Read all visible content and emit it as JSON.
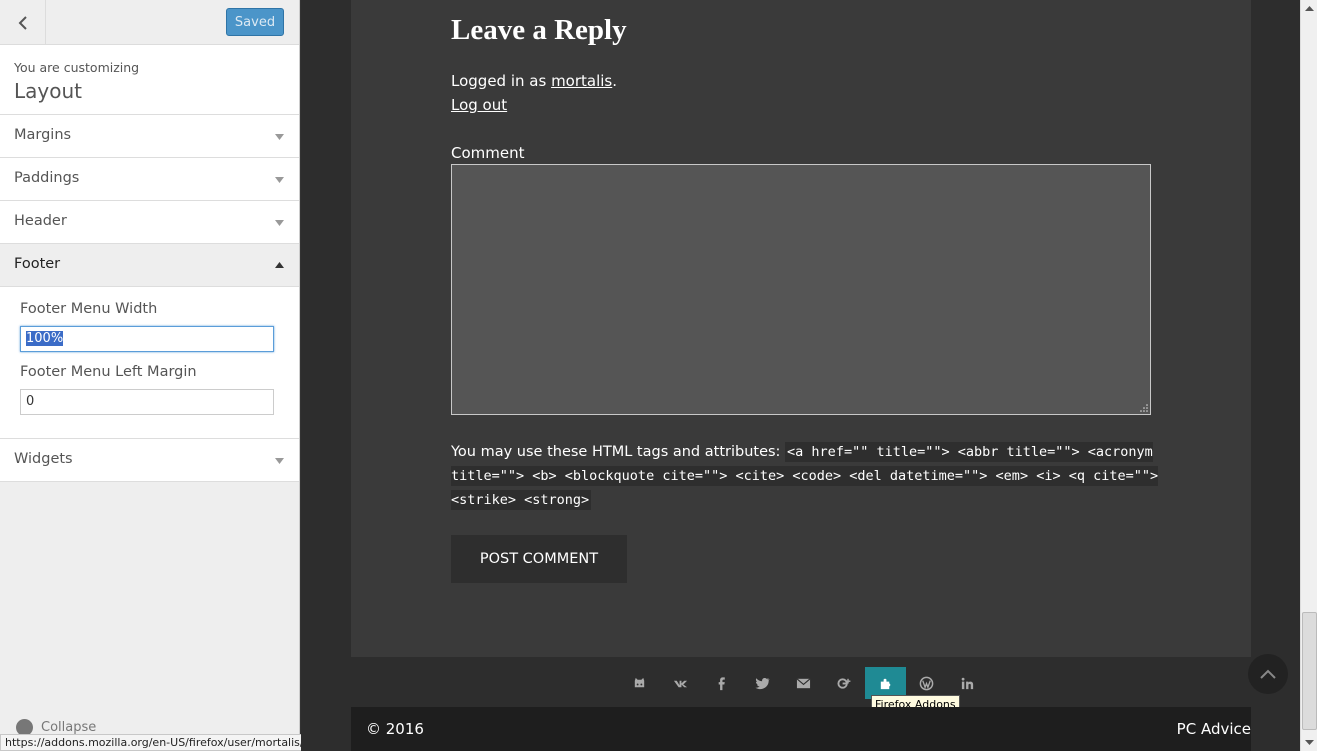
{
  "customizer": {
    "save_label": "Saved",
    "customizing_text": "You are customizing",
    "panel_title": "Layout",
    "sections": [
      {
        "label": "Margins"
      },
      {
        "label": "Paddings"
      },
      {
        "label": "Header"
      },
      {
        "label": "Footer"
      },
      {
        "label": "Widgets"
      }
    ],
    "footer_controls": {
      "menu_width_label": "Footer Menu Width",
      "menu_width_value": "100%",
      "menu_left_margin_label": "Footer Menu Left Margin",
      "menu_left_margin_value": "0"
    },
    "collapse_label": "Collapse",
    "accent_color": "#4b95c9"
  },
  "status_bar": {
    "url": "https://addons.mozilla.org/en-US/firefox/user/mortalis/"
  },
  "preview": {
    "reply_title": "Leave a Reply",
    "logged_in_prefix": "Logged in as ",
    "username": "mortalis",
    "logout_label": "Log out",
    "comment_label": "Comment",
    "allowed_prefix": "You may use these HTML tags and attributes:",
    "allowed_tags": "<a href=\"\" title=\"\"> <abbr title=\"\"> <acronym title=\"\"> <b> <blockquote cite=\"\"> <cite> <code> <del datetime=\"\"> <em> <i> <q cite=\"\"> <strike> <strong>",
    "post_button": "POST COMMENT",
    "social_icons": [
      "github-icon",
      "vk-icon",
      "facebook-icon",
      "twitter-icon",
      "email-icon",
      "google-plus-icon",
      "firefox-addons-icon",
      "wordpress-icon",
      "linkedin-icon"
    ],
    "active_social": "firefox-addons-icon",
    "tooltip": "Firefox Addons",
    "copyright": "© 2016",
    "site_name": "PC Advice",
    "social_active_color": "#1f8a94"
  }
}
